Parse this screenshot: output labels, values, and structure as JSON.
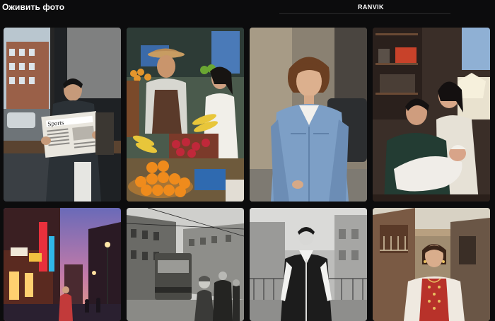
{
  "header": {
    "title": "Оживить фото",
    "brand": "RANVIK"
  },
  "gallery": {
    "items": [
      {
        "name": "man-reading-newspaper-photo",
        "sign_text": "Sports"
      },
      {
        "name": "fruit-market-couple-photo"
      },
      {
        "name": "woman-denim-jacket-photo"
      },
      {
        "name": "family-with-newborn-photo"
      },
      {
        "name": "neon-street-evening-photo"
      },
      {
        "name": "vintage-tram-street-photo"
      },
      {
        "name": "man-tracksuit-bw-photo"
      },
      {
        "name": "woman-folk-dress-photo"
      }
    ]
  }
}
